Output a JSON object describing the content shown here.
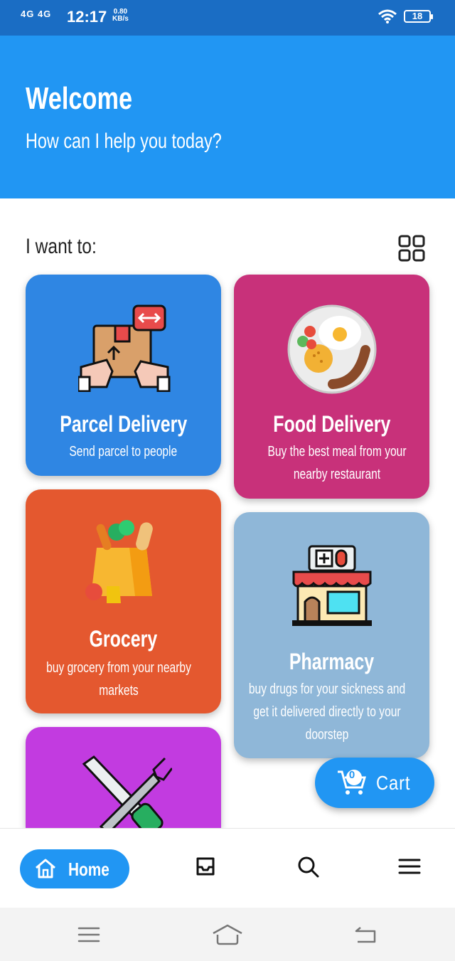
{
  "status_bar": {
    "network": "4G 4G",
    "time": "12:17",
    "speed_value": "0.80",
    "speed_unit": "KB/s",
    "battery": "18"
  },
  "header": {
    "title": "Welcome",
    "subtitle": "How can I help you today?",
    "background": "#2196f3"
  },
  "section": {
    "label": "I want to:",
    "view_toggle_icon": "grid-icon"
  },
  "services": [
    {
      "title": "Parcel Delivery",
      "description": "Send parcel to people",
      "color": "#2f86e3",
      "icon": "parcel-box-icon"
    },
    {
      "title": "Food Delivery",
      "description": "Buy the best meal from your nearby restaurant",
      "color": "#c8317a",
      "icon": "food-plate-icon"
    },
    {
      "title": "Grocery",
      "description": "buy grocery from your nearby markets",
      "color": "#e4582f",
      "icon": "grocery-bag-icon"
    },
    {
      "title": "Pharmacy",
      "description": "buy drugs for your sickness and get it delivered directly to your doorstep",
      "color": "#8fb7d8",
      "icon": "pharmacy-store-icon"
    },
    {
      "title": "",
      "description": "",
      "color": "#c23be0",
      "icon": "tools-icon"
    }
  ],
  "cart": {
    "label": "Cart",
    "count": "0"
  },
  "bottom_nav": {
    "home_label": "Home",
    "items": [
      "home-icon",
      "inbox-icon",
      "search-icon",
      "menu-icon"
    ]
  }
}
